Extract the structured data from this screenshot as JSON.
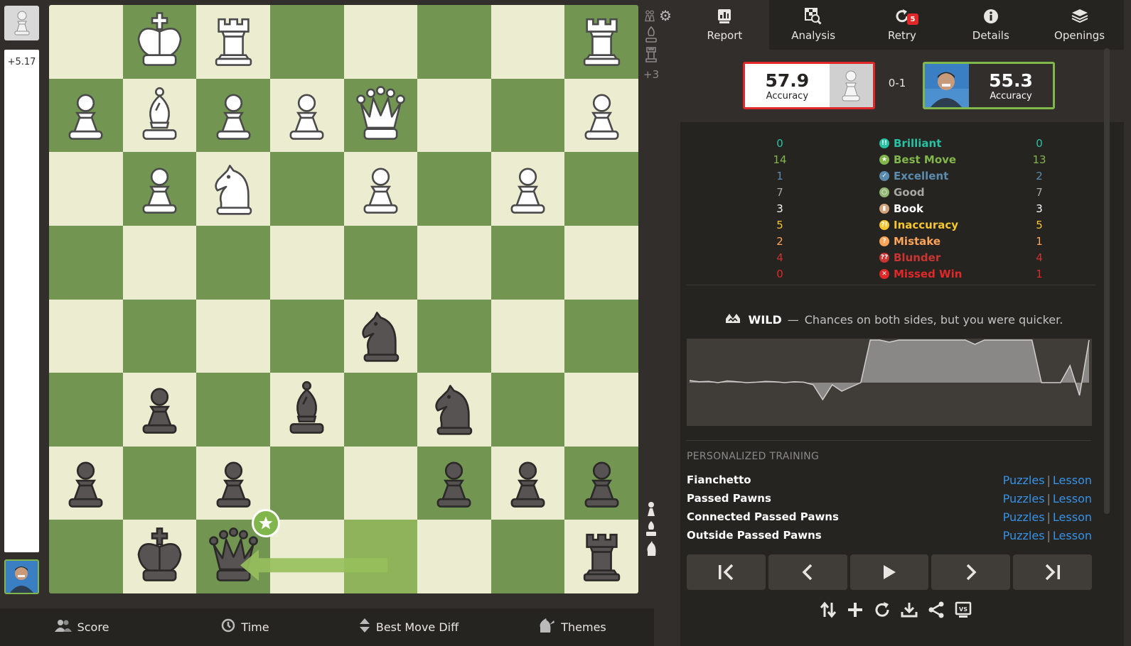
{
  "eval": {
    "label": "+5.17",
    "white_fraction": 1.0
  },
  "board": {
    "orientation": "black",
    "squares": [
      [
        "",
        "wK",
        "wR",
        "",
        "",
        "",
        "",
        "wR"
      ],
      [
        "wP",
        "wB",
        "wP",
        "wP",
        "wQ",
        "",
        "",
        "wP"
      ],
      [
        "",
        "wP",
        "wN",
        "",
        "wP",
        "",
        "wP",
        ""
      ],
      [
        "",
        "",
        "",
        "",
        "",
        "",
        "",
        ""
      ],
      [
        "",
        "",
        "",
        "",
        "bN",
        "",
        "",
        ""
      ],
      [
        "",
        "bP",
        "",
        "bB",
        "",
        "bN",
        "",
        ""
      ],
      [
        "bP",
        "",
        "bP",
        "",
        "",
        "bP",
        "bP",
        "bP"
      ],
      [
        "",
        "bK",
        "bQ",
        "",
        "",
        "",
        "",
        "bR"
      ]
    ],
    "highlighted": [
      [
        7,
        4
      ]
    ],
    "arrow": {
      "from": [
        7,
        4
      ],
      "to": [
        7,
        2
      ],
      "color": "#97c05c"
    },
    "best_marker_square": [
      7,
      2
    ]
  },
  "captured": {
    "top": [
      "pawn-pair",
      "bishop",
      "rook"
    ],
    "material_diff": "+3",
    "bottom": [
      "pawn",
      "bishop",
      "knight"
    ]
  },
  "bottom_bar": {
    "score": "Score",
    "time": "Time",
    "best_move_diff": "Best Move Diff",
    "themes": "Themes"
  },
  "tabs": [
    {
      "label": "Report",
      "icon": "report-icon",
      "active": true
    },
    {
      "label": "Analysis",
      "icon": "analysis-icon"
    },
    {
      "label": "Retry",
      "icon": "retry-icon",
      "badge": "5"
    },
    {
      "label": "Details",
      "icon": "info-icon"
    },
    {
      "label": "Openings",
      "icon": "openings-icon"
    }
  ],
  "summary": {
    "white": {
      "accuracy": "57.9",
      "label": "Accuracy"
    },
    "result": "0-1",
    "black": {
      "accuracy": "55.3",
      "label": "Accuracy"
    }
  },
  "stats": [
    {
      "name": "Brilliant",
      "white": "0",
      "black": "0",
      "color": "#26c2a3",
      "glyph": "!!"
    },
    {
      "name": "Best Move",
      "white": "14",
      "black": "13",
      "color": "#81b64c",
      "glyph": "★"
    },
    {
      "name": "Excellent",
      "white": "1",
      "black": "2",
      "color": "#5b8baf",
      "glyph": "✓"
    },
    {
      "name": "Good",
      "white": "7",
      "black": "7",
      "color": "#95b776",
      "glyph": "○"
    },
    {
      "name": "Book",
      "white": "3",
      "black": "3",
      "color": "#d5a47d",
      "glyph": "▮"
    },
    {
      "name": "Inaccuracy",
      "white": "5",
      "black": "5",
      "color": "#f7c631",
      "glyph": "?!"
    },
    {
      "name": "Mistake",
      "white": "2",
      "black": "1",
      "color": "#ffa459",
      "glyph": "?"
    },
    {
      "name": "Blunder",
      "white": "4",
      "black": "4",
      "color": "#ca3431",
      "glyph": "??"
    },
    {
      "name": "Missed Win",
      "white": "0",
      "black": "1",
      "color": "#e02828",
      "glyph": "✕"
    }
  ],
  "stat_text_colors": {
    "Brilliant": "#26c2a3",
    "Best Move": "#81b64c",
    "Excellent": "#5b8baf",
    "Good": "#a7a6a2",
    "Book": "#ffffff",
    "Inaccuracy": "#f7c631",
    "Mistake": "#ffa459",
    "Blunder": "#ca3431",
    "Missed Win": "#e02828"
  },
  "game_type": {
    "name": "WILD",
    "separator": "—",
    "description": "Chances on both sides, but you were quicker."
  },
  "graph_values": [
    0.05,
    0.02,
    0.03,
    0.0,
    0.04,
    0.02,
    0.0,
    0.01,
    0.03,
    0.02,
    0.0,
    0.02,
    0.01,
    -0.05,
    -0.4,
    -0.05,
    -0.2,
    -0.1,
    0.0,
    1.0,
    1.0,
    0.95,
    1.0,
    1.0,
    1.0,
    1.0,
    1.0,
    1.0,
    1.0,
    1.0,
    0.9,
    1.0,
    1.0,
    1.0,
    1.0,
    1.0,
    1.0,
    0.0,
    0.0,
    0.0,
    0.4,
    -0.3,
    1.0
  ],
  "training": {
    "title": "PERSONALIZED TRAINING",
    "items": [
      {
        "name": "Fianchetto",
        "puzzles": "Puzzles",
        "sep": "|",
        "lesson": "Lesson"
      },
      {
        "name": "Passed Pawns",
        "puzzles": "Puzzles",
        "sep": "|",
        "lesson": "Lesson"
      },
      {
        "name": "Connected Passed Pawns",
        "puzzles": "Puzzles",
        "sep": "|",
        "lesson": "Lesson"
      },
      {
        "name": "Outside Passed Pawns",
        "puzzles": "Puzzles",
        "sep": "|",
        "lesson": "Lesson"
      }
    ]
  },
  "nav": [
    "first-move-icon",
    "previous-move-icon",
    "play-icon",
    "next-move-icon",
    "last-move-icon"
  ],
  "actions": [
    "flip-board-icon",
    "add-icon",
    "refresh-icon",
    "download-icon",
    "share-icon",
    "versus-icon"
  ]
}
